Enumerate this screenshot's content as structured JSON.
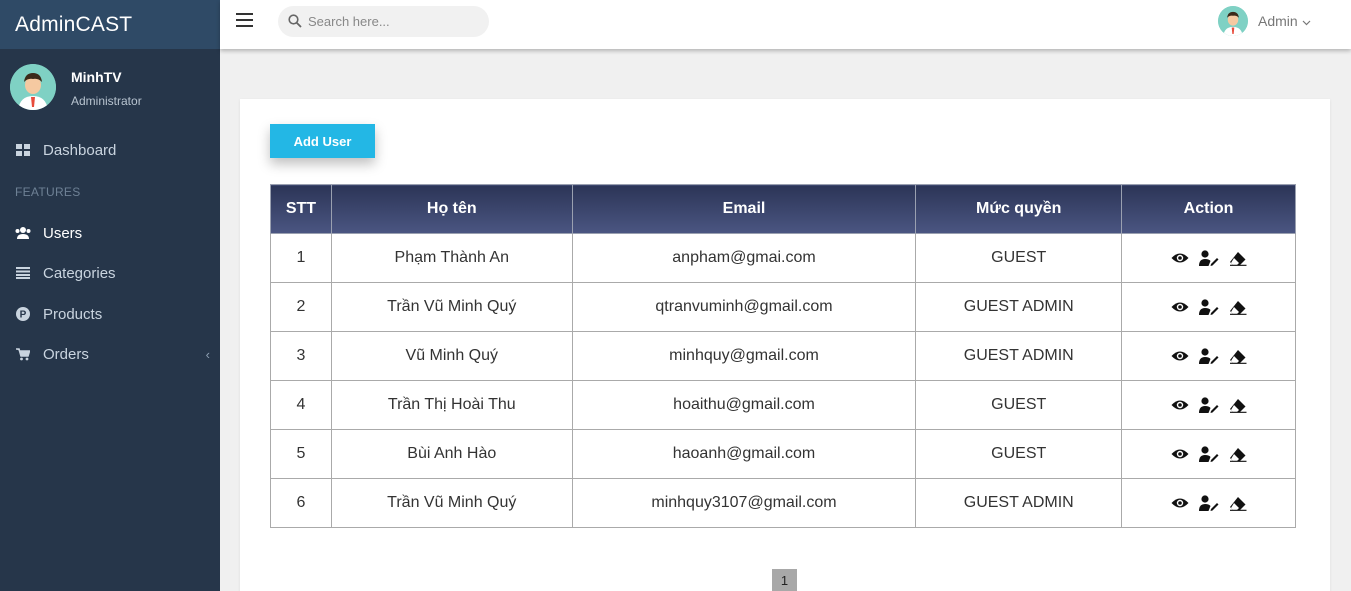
{
  "sidebar": {
    "brand": "AdminCAST",
    "user": {
      "name": "MinhTV",
      "role": "Administrator",
      "avatar_icon": "user-avatar-icon"
    },
    "dashboard": {
      "label": "Dashboard",
      "icon": "dashboard-icon"
    },
    "heading": "FEATURES",
    "items": [
      {
        "label": "Users",
        "icon": "users-icon",
        "active": true
      },
      {
        "label": "Categories",
        "icon": "list-icon"
      },
      {
        "label": "Products",
        "icon": "product-icon"
      },
      {
        "label": "Orders",
        "icon": "cart-icon"
      }
    ]
  },
  "header": {
    "search_placeholder": "Search here...",
    "user_label": "Admin"
  },
  "main": {
    "add_button": "Add User",
    "columns": [
      "STT",
      "Họ tên",
      "Email",
      "Mức quyền",
      "Action"
    ],
    "rows": [
      {
        "stt": "1",
        "name": "Phạm Thành An",
        "email": "anpham@gmai.com",
        "role": "GUEST"
      },
      {
        "stt": "2",
        "name": "Trần Vũ Minh Quý",
        "email": "qtranvuminh@gmail.com",
        "role": "GUEST ADMIN"
      },
      {
        "stt": "3",
        "name": "Vũ Minh Quý",
        "email": "minhquy@gmail.com",
        "role": "GUEST ADMIN"
      },
      {
        "stt": "4",
        "name": "Trần Thị Hoài Thu",
        "email": "hoaithu@gmail.com",
        "role": "GUEST"
      },
      {
        "stt": "5",
        "name": "Bùi Anh Hào",
        "email": "haoanh@gmail.com",
        "role": "GUEST"
      },
      {
        "stt": "6",
        "name": "Trần Vũ Minh Quý",
        "email": "minhquy3107@gmail.com",
        "role": "GUEST ADMIN"
      }
    ],
    "page": "1"
  },
  "colors": {
    "accent": "#23b7e5",
    "sidebar": "#26364a",
    "table_header": "#2c3557"
  }
}
